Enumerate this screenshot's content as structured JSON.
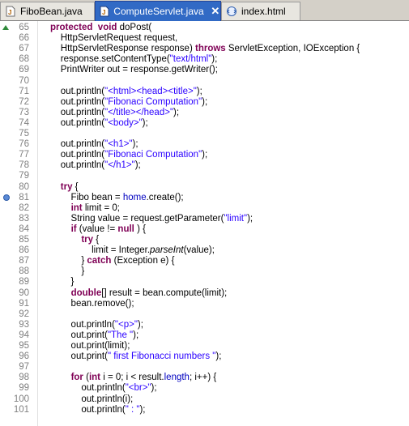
{
  "tabs": [
    {
      "label": "FiboBean.java",
      "icon": "java-file-icon",
      "active": false
    },
    {
      "label": "ComputeServlet.java",
      "icon": "java-file-icon",
      "active": true,
      "close": "✕"
    },
    {
      "label": "index.html",
      "icon": "html-file-icon",
      "active": false
    }
  ],
  "colors": {
    "keyword": "#7f0055",
    "string": "#2a00ff",
    "field": "#0000c0",
    "tab_active": "#316ac5"
  },
  "lines": [
    {
      "n": "65",
      "fold": true,
      "segs": [
        [
          "kw",
          "protected"
        ],
        [
          "",
          "  "
        ],
        [
          "kw",
          "void"
        ],
        [
          "",
          " doPost("
        ]
      ]
    },
    {
      "n": "66",
      "segs": [
        [
          "",
          "    HttpServletRequest request,"
        ]
      ]
    },
    {
      "n": "67",
      "segs": [
        [
          "",
          "    HttpServletResponse response) "
        ],
        [
          "kw",
          "throws"
        ],
        [
          "",
          " ServletException, IOException {"
        ]
      ]
    },
    {
      "n": "68",
      "segs": [
        [
          "",
          "    response.setContentType("
        ],
        [
          "str",
          "\"text/html\""
        ],
        [
          "",
          ");"
        ]
      ]
    },
    {
      "n": "69",
      "segs": [
        [
          "",
          "    PrintWriter out = response.getWriter();"
        ]
      ]
    },
    {
      "n": "70",
      "segs": []
    },
    {
      "n": "71",
      "segs": [
        [
          "",
          "    out.println("
        ],
        [
          "str",
          "\"<html><head><title>\""
        ],
        [
          "",
          ");"
        ]
      ]
    },
    {
      "n": "72",
      "segs": [
        [
          "",
          "    out.println("
        ],
        [
          "str",
          "\"Fibonaci Computation\""
        ],
        [
          "",
          ");"
        ]
      ]
    },
    {
      "n": "73",
      "segs": [
        [
          "",
          "    out.println("
        ],
        [
          "str",
          "\"</title></head>\""
        ],
        [
          "",
          ");"
        ]
      ]
    },
    {
      "n": "74",
      "segs": [
        [
          "",
          "    out.println("
        ],
        [
          "str",
          "\"<body>\""
        ],
        [
          "",
          ");"
        ]
      ]
    },
    {
      "n": "75",
      "segs": []
    },
    {
      "n": "76",
      "segs": [
        [
          "",
          "    out.println("
        ],
        [
          "str",
          "\"<h1>\""
        ],
        [
          "",
          ");"
        ]
      ]
    },
    {
      "n": "77",
      "segs": [
        [
          "",
          "    out.println("
        ],
        [
          "str",
          "\"Fibonaci Computation\""
        ],
        [
          "",
          ");"
        ]
      ]
    },
    {
      "n": "78",
      "segs": [
        [
          "",
          "    out.println("
        ],
        [
          "str",
          "\"</h1>\""
        ],
        [
          "",
          ");"
        ]
      ]
    },
    {
      "n": "79",
      "segs": []
    },
    {
      "n": "80",
      "segs": [
        [
          "",
          "    "
        ],
        [
          "kw",
          "try"
        ],
        [
          "",
          " {"
        ]
      ]
    },
    {
      "n": "81",
      "marker": true,
      "segs": [
        [
          "",
          "        Fibo bean = "
        ],
        [
          "fld",
          "home"
        ],
        [
          "",
          ".create();"
        ]
      ]
    },
    {
      "n": "82",
      "segs": [
        [
          "",
          "        "
        ],
        [
          "kw",
          "int"
        ],
        [
          "",
          " limit = 0;"
        ]
      ]
    },
    {
      "n": "83",
      "segs": [
        [
          "",
          "        String value = request.getParameter("
        ],
        [
          "str",
          "\"limit\""
        ],
        [
          "",
          ");"
        ]
      ]
    },
    {
      "n": "84",
      "segs": [
        [
          "",
          "        "
        ],
        [
          "kw",
          "if"
        ],
        [
          "",
          " (value != "
        ],
        [
          "kw",
          "null"
        ],
        [
          "",
          " ) {"
        ]
      ]
    },
    {
      "n": "85",
      "segs": [
        [
          "",
          "            "
        ],
        [
          "kw",
          "try"
        ],
        [
          "",
          " {"
        ]
      ]
    },
    {
      "n": "86",
      "segs": [
        [
          "",
          "                limit = Integer."
        ],
        [
          "it",
          "parseInt"
        ],
        [
          "",
          "(value);"
        ]
      ]
    },
    {
      "n": "87",
      "segs": [
        [
          "",
          "            } "
        ],
        [
          "kw",
          "catch"
        ],
        [
          "",
          " (Exception e) {"
        ]
      ]
    },
    {
      "n": "88",
      "segs": [
        [
          "",
          "            }"
        ]
      ]
    },
    {
      "n": "89",
      "segs": [
        [
          "",
          "        }"
        ]
      ]
    },
    {
      "n": "90",
      "segs": [
        [
          "",
          "        "
        ],
        [
          "kw",
          "double"
        ],
        [
          "",
          "[] result = bean.compute(limit);"
        ]
      ]
    },
    {
      "n": "91",
      "segs": [
        [
          "",
          "        bean.remove();"
        ]
      ]
    },
    {
      "n": "92",
      "segs": []
    },
    {
      "n": "93",
      "segs": [
        [
          "",
          "        out.println("
        ],
        [
          "str",
          "\"<p>\""
        ],
        [
          "",
          ");"
        ]
      ]
    },
    {
      "n": "94",
      "segs": [
        [
          "",
          "        out.print("
        ],
        [
          "str",
          "\"The \""
        ],
        [
          "",
          ");"
        ]
      ]
    },
    {
      "n": "95",
      "segs": [
        [
          "",
          "        out.print(limit);"
        ]
      ]
    },
    {
      "n": "96",
      "segs": [
        [
          "",
          "        out.print("
        ],
        [
          "str",
          "\" first Fibonacci numbers \""
        ],
        [
          "",
          ");"
        ]
      ]
    },
    {
      "n": "97",
      "segs": []
    },
    {
      "n": "98",
      "segs": [
        [
          "",
          "        "
        ],
        [
          "kw",
          "for"
        ],
        [
          "",
          " ("
        ],
        [
          "kw",
          "int"
        ],
        [
          "",
          " i = 0; i < result."
        ],
        [
          "fld",
          "length"
        ],
        [
          "",
          "; i++) {"
        ]
      ]
    },
    {
      "n": "99",
      "segs": [
        [
          "",
          "            out.println("
        ],
        [
          "str",
          "\"<br>\""
        ],
        [
          "",
          ");"
        ]
      ]
    },
    {
      "n": "100",
      "segs": [
        [
          "",
          "            out.println(i);"
        ]
      ]
    },
    {
      "n": "101",
      "segs": [
        [
          "",
          "            out.println("
        ],
        [
          "str",
          "\" : \""
        ],
        [
          "",
          ");"
        ]
      ]
    }
  ]
}
